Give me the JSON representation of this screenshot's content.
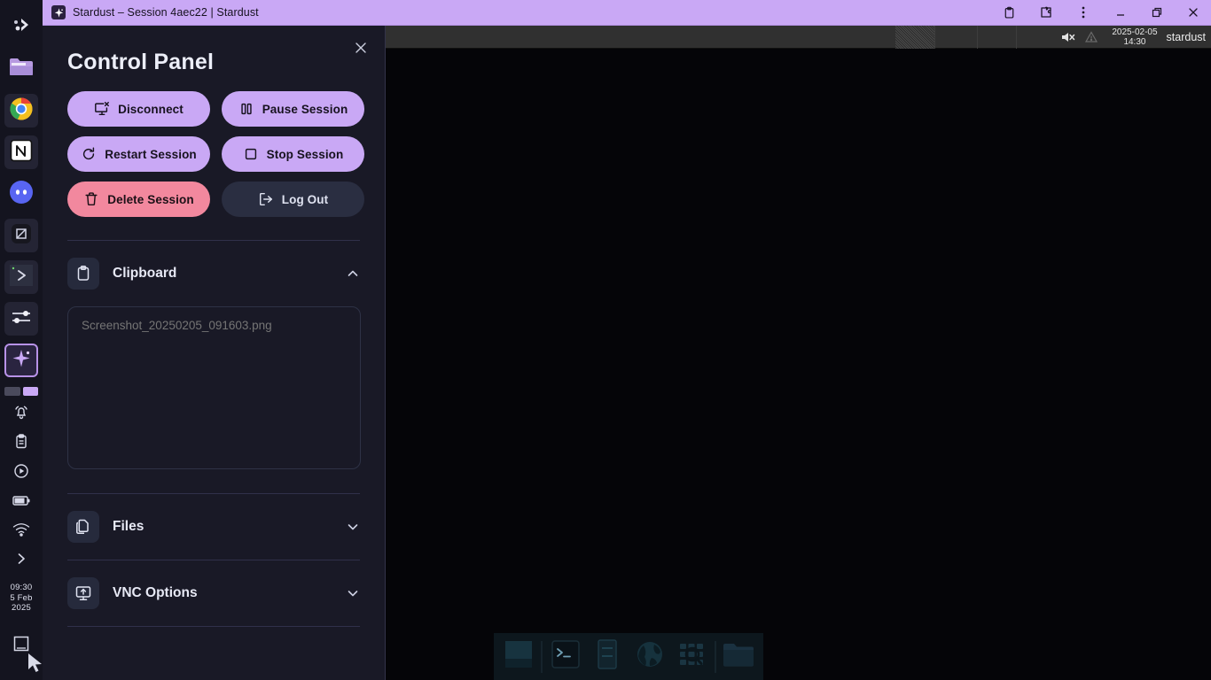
{
  "titlebar": {
    "title": "Stardust – Session 4aec22 | Stardust",
    "app_icon": "stardust-star-icon",
    "actions": [
      {
        "name": "clipboard-icon",
        "label": "Clipboard"
      },
      {
        "name": "extensions-icon",
        "label": "Extensions"
      },
      {
        "name": "more-menu-icon",
        "label": "More"
      }
    ],
    "window_controls": [
      {
        "name": "minimize-button",
        "label": "Minimize"
      },
      {
        "name": "maximize-button",
        "label": "Restore"
      },
      {
        "name": "close-button",
        "label": "Close"
      }
    ],
    "bg_color": "#c9a8f5"
  },
  "dock": {
    "apps": [
      {
        "name": "kde-menu-icon",
        "label": "Application Menu"
      },
      {
        "name": "file-manager-icon",
        "label": "Files"
      },
      {
        "name": "chrome-icon",
        "label": "Google Chrome"
      },
      {
        "name": "notion-icon",
        "label": "Notion"
      },
      {
        "name": "discord-icon",
        "label": "Discord"
      },
      {
        "name": "obsidian-icon",
        "label": "Obsidian"
      },
      {
        "name": "terminal-icon",
        "label": "Terminal"
      },
      {
        "name": "settings-icon",
        "label": "Settings"
      },
      {
        "name": "stardust-icon",
        "label": "Stardust"
      }
    ],
    "tray": [
      {
        "name": "notifications-icon",
        "label": "Notifications"
      },
      {
        "name": "clipboard-tray-icon",
        "label": "Clipboard"
      },
      {
        "name": "media-player-icon",
        "label": "Media Player"
      },
      {
        "name": "battery-icon",
        "label": "Battery"
      },
      {
        "name": "wifi-icon",
        "label": "Network"
      },
      {
        "name": "tray-expand-icon",
        "label": "Show hidden icons"
      }
    ],
    "clock": {
      "time": "09:30",
      "day": "5 Feb",
      "year": "2025"
    },
    "show_desktop": {
      "name": "show-desktop-icon",
      "label": "Show Desktop"
    }
  },
  "panel": {
    "title": "Control Panel",
    "close_label": "×",
    "buttons": [
      {
        "id": "disconnect",
        "label": "Disconnect",
        "icon": "monitor-x-icon",
        "style": "purple"
      },
      {
        "id": "pause-session",
        "label": "Pause Session",
        "icon": "pause-icon",
        "style": "purple"
      },
      {
        "id": "restart-session",
        "label": "Restart Session",
        "icon": "refresh-cw-icon",
        "style": "purple"
      },
      {
        "id": "stop-session",
        "label": "Stop Session",
        "icon": "square-icon",
        "style": "purple"
      },
      {
        "id": "delete-session",
        "label": "Delete Session",
        "icon": "trash-icon",
        "style": "pink"
      },
      {
        "id": "log-out",
        "label": "Log Out",
        "icon": "log-out-icon",
        "style": "dark"
      }
    ],
    "sections": [
      {
        "id": "clipboard",
        "label": "Clipboard",
        "icon": "clipboard-icon",
        "expanded": true,
        "chevron": "chevron-up-icon"
      },
      {
        "id": "files",
        "label": "Files",
        "icon": "copy-files-icon",
        "expanded": false,
        "chevron": "chevron-down-icon"
      },
      {
        "id": "vnc-options",
        "label": "VNC Options",
        "icon": "monitor-upload-icon",
        "expanded": false,
        "chevron": "chevron-down-icon"
      }
    ],
    "clipboard": {
      "value": "",
      "placeholder": "Screenshot_20250205_091603.png"
    },
    "colors": {
      "background": "#191926",
      "accent_purple": "#c9a8f5",
      "danger_pink": "#f2889e",
      "neutral_dark": "#2a2e41"
    }
  },
  "remote": {
    "topbar": {
      "volume_icon": "volume-muted-icon",
      "warning_icon": "warning-triangle-icon",
      "datetime_date": "2025-02-05",
      "datetime_time": "14:30",
      "user": "stardust"
    },
    "dock_items": [
      {
        "name": "app-tile-icon",
        "label": "App"
      },
      {
        "name": "terminal-app-icon",
        "label": "Terminal"
      },
      {
        "name": "book-app-icon",
        "label": "Documents"
      },
      {
        "name": "globe-browser-icon",
        "label": "Web Browser"
      },
      {
        "name": "app-search-icon",
        "label": "Show Applications"
      },
      {
        "name": "folder-app-icon",
        "label": "File Manager"
      }
    ]
  }
}
